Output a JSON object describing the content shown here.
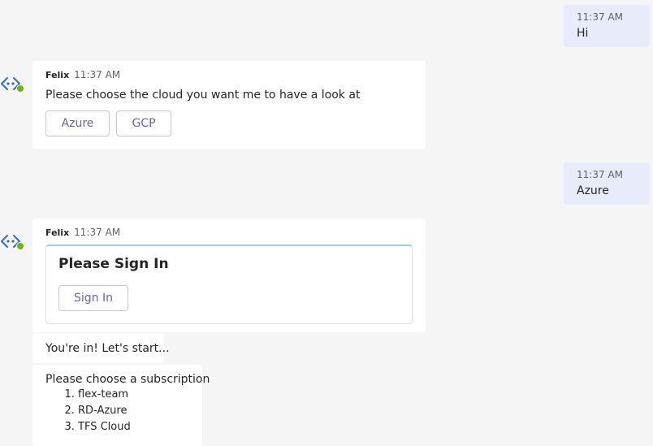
{
  "bot": {
    "name": "Felix",
    "presence_color": "#6bb700"
  },
  "messages": {
    "user_hi": {
      "time": "11:37 AM",
      "text": "Hi"
    },
    "bot_choose_cloud": {
      "time": "11:37 AM",
      "text": "Please choose the cloud you want me to have a look at",
      "options": [
        "Azure",
        "GCP"
      ]
    },
    "user_azure": {
      "time": "11:37 AM",
      "text": "Azure"
    },
    "bot_sign_in": {
      "time": "11:37 AM",
      "card_title": "Please Sign In",
      "button_label": "Sign In"
    },
    "bot_youre_in": {
      "text": "You're in! Let's start..."
    },
    "bot_subscriptions": {
      "text": "Please choose a subscription",
      "items": [
        "flex-team",
        "RD-Azure",
        "TFS Cloud"
      ]
    }
  },
  "colors": {
    "background": "#f5f5f5",
    "user_bubble": "#e8ebfa",
    "bot_bubble": "#ffffff",
    "accent": "#6264a7",
    "bot_icon": "#2f6fbf"
  }
}
